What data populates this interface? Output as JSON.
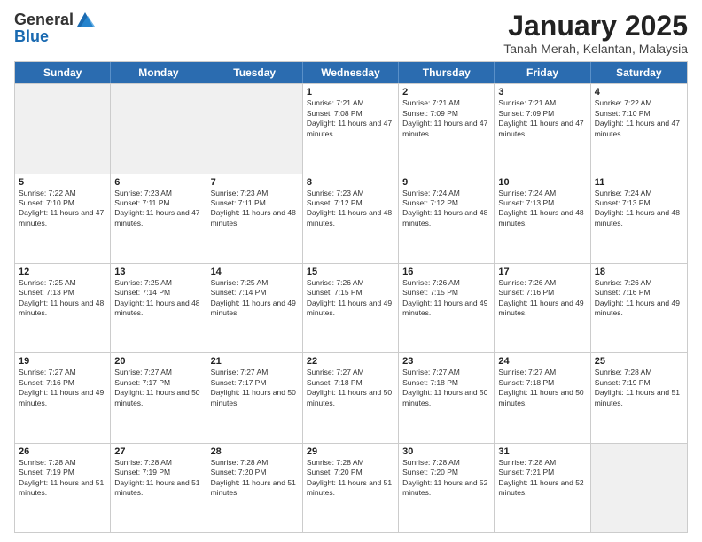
{
  "header": {
    "logo_general": "General",
    "logo_blue": "Blue",
    "main_title": "January 2025",
    "subtitle": "Tanah Merah, Kelantan, Malaysia"
  },
  "calendar": {
    "days_of_week": [
      "Sunday",
      "Monday",
      "Tuesday",
      "Wednesday",
      "Thursday",
      "Friday",
      "Saturday"
    ],
    "weeks": [
      [
        {
          "day": "",
          "info": ""
        },
        {
          "day": "",
          "info": ""
        },
        {
          "day": "",
          "info": ""
        },
        {
          "day": "1",
          "info": "Sunrise: 7:21 AM\nSunset: 7:08 PM\nDaylight: 11 hours and 47 minutes."
        },
        {
          "day": "2",
          "info": "Sunrise: 7:21 AM\nSunset: 7:09 PM\nDaylight: 11 hours and 47 minutes."
        },
        {
          "day": "3",
          "info": "Sunrise: 7:21 AM\nSunset: 7:09 PM\nDaylight: 11 hours and 47 minutes."
        },
        {
          "day": "4",
          "info": "Sunrise: 7:22 AM\nSunset: 7:10 PM\nDaylight: 11 hours and 47 minutes."
        }
      ],
      [
        {
          "day": "5",
          "info": "Sunrise: 7:22 AM\nSunset: 7:10 PM\nDaylight: 11 hours and 47 minutes."
        },
        {
          "day": "6",
          "info": "Sunrise: 7:23 AM\nSunset: 7:11 PM\nDaylight: 11 hours and 47 minutes."
        },
        {
          "day": "7",
          "info": "Sunrise: 7:23 AM\nSunset: 7:11 PM\nDaylight: 11 hours and 48 minutes."
        },
        {
          "day": "8",
          "info": "Sunrise: 7:23 AM\nSunset: 7:12 PM\nDaylight: 11 hours and 48 minutes."
        },
        {
          "day": "9",
          "info": "Sunrise: 7:24 AM\nSunset: 7:12 PM\nDaylight: 11 hours and 48 minutes."
        },
        {
          "day": "10",
          "info": "Sunrise: 7:24 AM\nSunset: 7:13 PM\nDaylight: 11 hours and 48 minutes."
        },
        {
          "day": "11",
          "info": "Sunrise: 7:24 AM\nSunset: 7:13 PM\nDaylight: 11 hours and 48 minutes."
        }
      ],
      [
        {
          "day": "12",
          "info": "Sunrise: 7:25 AM\nSunset: 7:13 PM\nDaylight: 11 hours and 48 minutes."
        },
        {
          "day": "13",
          "info": "Sunrise: 7:25 AM\nSunset: 7:14 PM\nDaylight: 11 hours and 48 minutes."
        },
        {
          "day": "14",
          "info": "Sunrise: 7:25 AM\nSunset: 7:14 PM\nDaylight: 11 hours and 49 minutes."
        },
        {
          "day": "15",
          "info": "Sunrise: 7:26 AM\nSunset: 7:15 PM\nDaylight: 11 hours and 49 minutes."
        },
        {
          "day": "16",
          "info": "Sunrise: 7:26 AM\nSunset: 7:15 PM\nDaylight: 11 hours and 49 minutes."
        },
        {
          "day": "17",
          "info": "Sunrise: 7:26 AM\nSunset: 7:16 PM\nDaylight: 11 hours and 49 minutes."
        },
        {
          "day": "18",
          "info": "Sunrise: 7:26 AM\nSunset: 7:16 PM\nDaylight: 11 hours and 49 minutes."
        }
      ],
      [
        {
          "day": "19",
          "info": "Sunrise: 7:27 AM\nSunset: 7:16 PM\nDaylight: 11 hours and 49 minutes."
        },
        {
          "day": "20",
          "info": "Sunrise: 7:27 AM\nSunset: 7:17 PM\nDaylight: 11 hours and 50 minutes."
        },
        {
          "day": "21",
          "info": "Sunrise: 7:27 AM\nSunset: 7:17 PM\nDaylight: 11 hours and 50 minutes."
        },
        {
          "day": "22",
          "info": "Sunrise: 7:27 AM\nSunset: 7:18 PM\nDaylight: 11 hours and 50 minutes."
        },
        {
          "day": "23",
          "info": "Sunrise: 7:27 AM\nSunset: 7:18 PM\nDaylight: 11 hours and 50 minutes."
        },
        {
          "day": "24",
          "info": "Sunrise: 7:27 AM\nSunset: 7:18 PM\nDaylight: 11 hours and 50 minutes."
        },
        {
          "day": "25",
          "info": "Sunrise: 7:28 AM\nSunset: 7:19 PM\nDaylight: 11 hours and 51 minutes."
        }
      ],
      [
        {
          "day": "26",
          "info": "Sunrise: 7:28 AM\nSunset: 7:19 PM\nDaylight: 11 hours and 51 minutes."
        },
        {
          "day": "27",
          "info": "Sunrise: 7:28 AM\nSunset: 7:19 PM\nDaylight: 11 hours and 51 minutes."
        },
        {
          "day": "28",
          "info": "Sunrise: 7:28 AM\nSunset: 7:20 PM\nDaylight: 11 hours and 51 minutes."
        },
        {
          "day": "29",
          "info": "Sunrise: 7:28 AM\nSunset: 7:20 PM\nDaylight: 11 hours and 51 minutes."
        },
        {
          "day": "30",
          "info": "Sunrise: 7:28 AM\nSunset: 7:20 PM\nDaylight: 11 hours and 52 minutes."
        },
        {
          "day": "31",
          "info": "Sunrise: 7:28 AM\nSunset: 7:21 PM\nDaylight: 11 hours and 52 minutes."
        },
        {
          "day": "",
          "info": ""
        }
      ]
    ]
  }
}
